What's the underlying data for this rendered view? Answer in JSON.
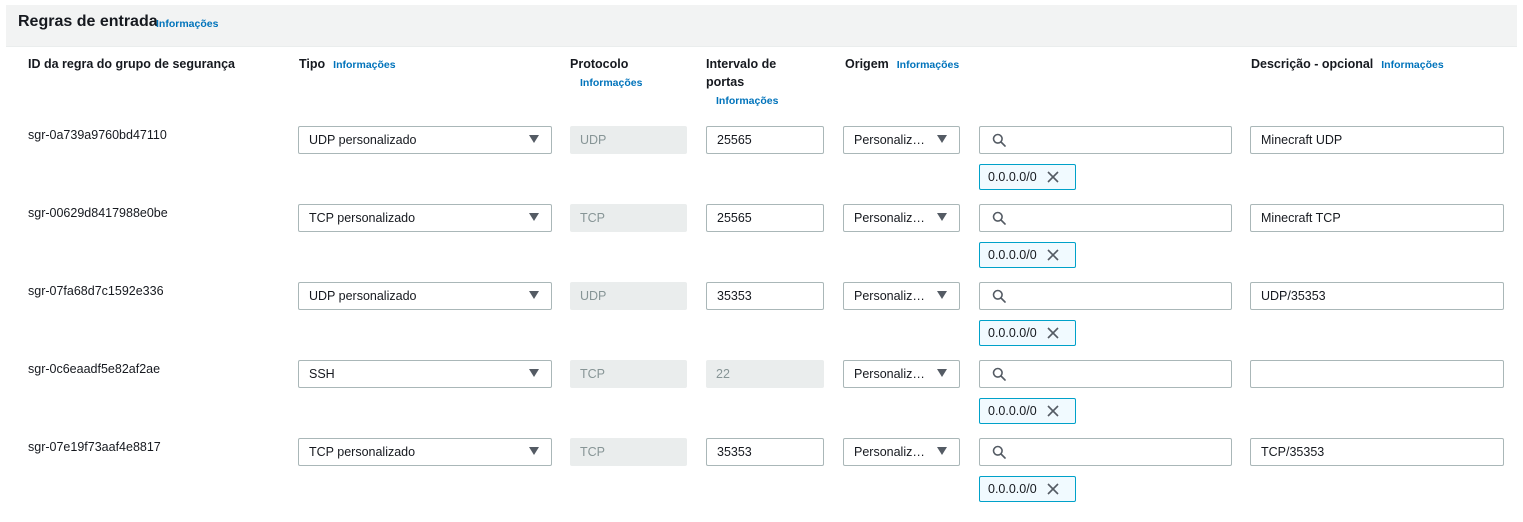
{
  "section": {
    "title": "Regras de entrada",
    "info": "Informações"
  },
  "columns": {
    "rule_id": "ID da regra do grupo de segurança",
    "type": "Tipo",
    "type_info": "Informações",
    "protocol_line1": "Protocolo",
    "protocol_info": "Informações",
    "port_line1": "Intervalo de",
    "port_line2": "portas",
    "port_info": "Informações",
    "source": "Origem",
    "source_info": "Informações",
    "description": "Descrição - opcional",
    "description_info": "Informações"
  },
  "rules": [
    {
      "id": "sgr-0a739a9760bd47110",
      "type": "UDP personalizado",
      "protocol": "UDP",
      "port": "25565",
      "source": "Personaliz…",
      "search": "",
      "cidr": "0.0.0.0/0",
      "description": "Minecraft UDP"
    },
    {
      "id": "sgr-00629d8417988e0be",
      "type": "TCP personalizado",
      "protocol": "TCP",
      "port": "25565",
      "source": "Personaliz…",
      "search": "",
      "cidr": "0.0.0.0/0",
      "description": "Minecraft TCP"
    },
    {
      "id": "sgr-07fa68d7c1592e336",
      "type": "UDP personalizado",
      "protocol": "UDP",
      "port": "35353",
      "source": "Personaliz…",
      "search": "",
      "cidr": "0.0.0.0/0",
      "description": "UDP/35353"
    },
    {
      "id": "sgr-0c6eaadf5e82af2ae",
      "type": "SSH",
      "protocol": "TCP",
      "port": "22",
      "source": "Personaliz…",
      "search": "",
      "cidr": "0.0.0.0/0",
      "description": ""
    },
    {
      "id": "sgr-07e19f73aaf4e8817",
      "type": "TCP personalizado",
      "protocol": "TCP",
      "port": "35353",
      "source": "Personaliz…",
      "search": "",
      "cidr": "0.0.0.0/0",
      "description": "TCP/35353"
    }
  ],
  "icons": {
    "caret": "caret-down-icon",
    "search": "search-icon",
    "remove": "close-icon"
  }
}
